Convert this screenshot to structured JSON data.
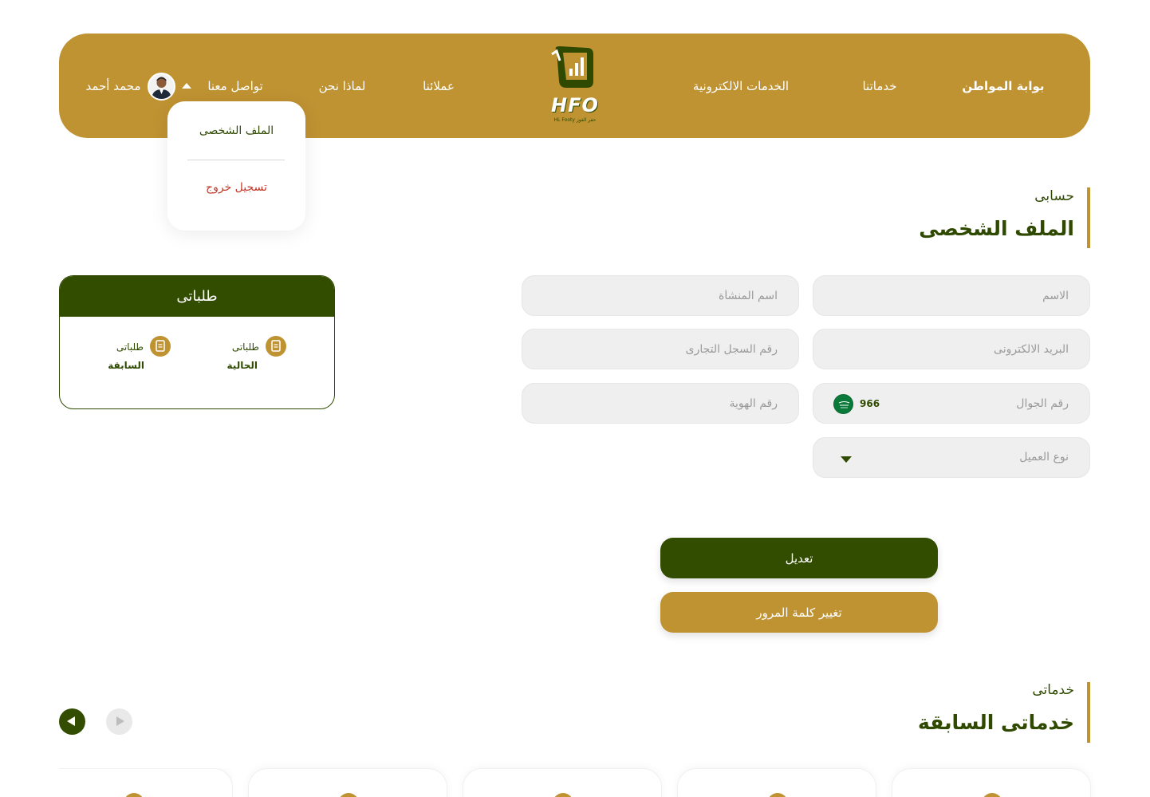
{
  "nav": {
    "links": [
      {
        "label": "بوابة المواطن",
        "active": true
      },
      {
        "label": "خدماتنا",
        "active": false
      },
      {
        "label": "الخدمات الالكترونية",
        "active": false
      },
      {
        "label": "عملائنا",
        "active": false
      },
      {
        "label": "لماذا نحن",
        "active": false
      },
      {
        "label": "تواصل معنا",
        "active": false
      }
    ],
    "logo_text": "HFO",
    "logo_tagline": "HL Footy حفر الفوز",
    "user_name": "محمد أحمد"
  },
  "dropdown": {
    "profile": "الملف الشخصى",
    "logout": "تسجيل خروج"
  },
  "account": {
    "subtitle": "حسابى",
    "title": "الملف الشخصى"
  },
  "form": {
    "name_placeholder": "الاسم",
    "company_placeholder": "اسم المنشأة",
    "email_placeholder": "البريد الالكترونى",
    "cr_placeholder": "رقم السجل التجارى",
    "phone_placeholder": "رقم الجوال",
    "phone_code": "966",
    "id_placeholder": "رقم الهوية",
    "client_type_placeholder": "نوع العميل",
    "edit_button": "تعديل",
    "change_password_button": "تغيير كلمة المرور"
  },
  "orders": {
    "title": "طلباتى",
    "items": [
      {
        "line1": "طلباتى",
        "line2": "الحالية"
      },
      {
        "line1": "طلباتى",
        "line2": "السابقة"
      }
    ]
  },
  "services": {
    "subtitle": "خدماتى",
    "title": "خدماتى السابقة"
  },
  "colors": {
    "gold": "#bf9232",
    "dark_green": "#324d00",
    "logout_red": "#c0392b"
  }
}
